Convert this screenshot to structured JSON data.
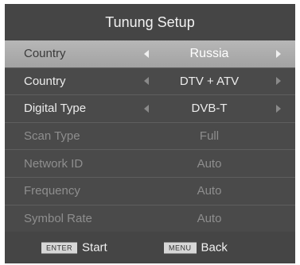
{
  "title": "Tunung Setup",
  "rows": [
    {
      "label": "Country",
      "value": "Russia"
    },
    {
      "label": "Country",
      "value": "DTV + ATV"
    },
    {
      "label": "Digital Type",
      "value": "DVB-T"
    },
    {
      "label": "Scan Type",
      "value": "Full"
    },
    {
      "label": "Network ID",
      "value": "Auto"
    },
    {
      "label": "Frequency",
      "value": "Auto"
    },
    {
      "label": "Symbol Rate",
      "value": "Auto"
    }
  ],
  "footer": {
    "enter_key": "ENTER",
    "enter_action": "Start",
    "menu_key": "MENU",
    "menu_action": "Back"
  },
  "icons": {
    "left": "left-arrow-icon",
    "right": "right-arrow-icon"
  },
  "colors": {
    "panel": "#4a4a4a",
    "selected_row": "#aeaeae",
    "disabled_text": "#8e8e8e"
  }
}
